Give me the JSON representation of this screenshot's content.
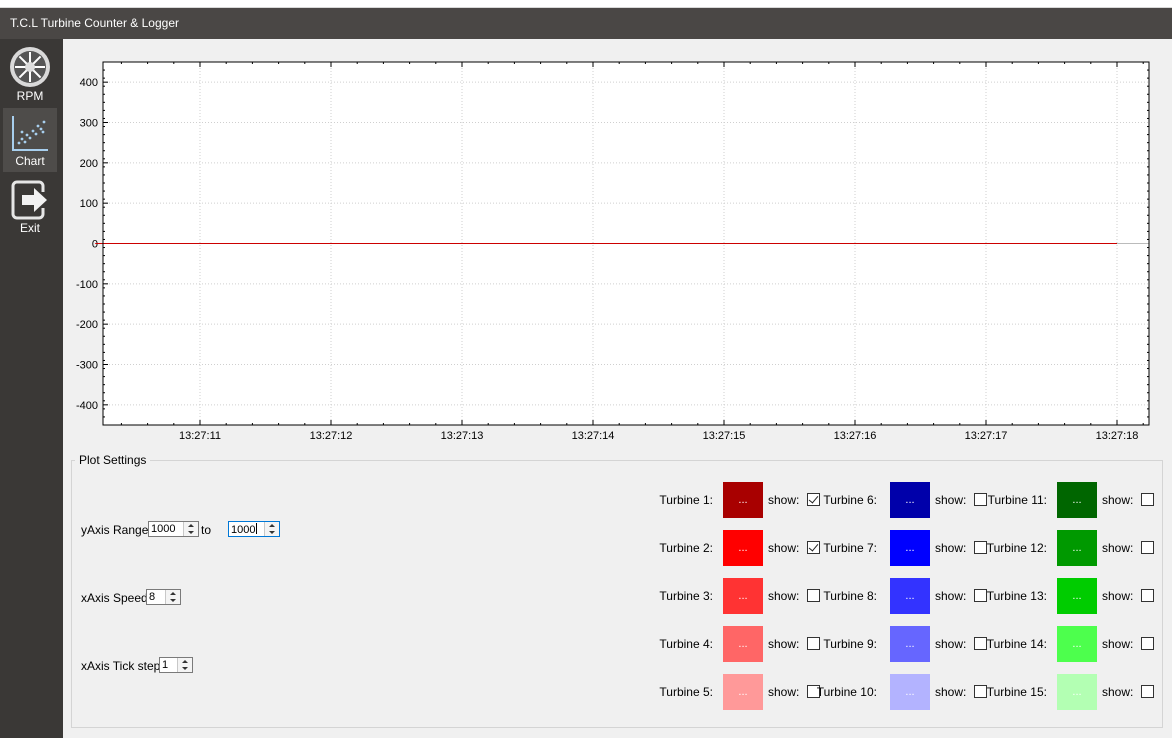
{
  "window": {
    "title": "T.C.L Turbine Counter & Logger"
  },
  "sidebar": {
    "items": [
      {
        "label": "RPM",
        "icon": "turbine-icon",
        "active": false
      },
      {
        "label": "Chart",
        "icon": "scatter-chart-icon",
        "active": true
      },
      {
        "label": "Exit",
        "icon": "exit-icon",
        "active": false
      }
    ]
  },
  "chart_data": {
    "type": "line",
    "title": "",
    "xlabel": "",
    "ylabel": "",
    "ylim": [
      -450,
      450
    ],
    "y_ticks": [
      "400",
      "300",
      "200",
      "100",
      "0",
      "-100",
      "-200",
      "-300",
      "-400"
    ],
    "x_ticks": [
      "13:27:11",
      "13:27:12",
      "13:27:13",
      "13:27:14",
      "13:27:15",
      "13:27:16",
      "13:27:17",
      "13:27:18"
    ],
    "grid": true,
    "series": [
      {
        "color": "#cc0000",
        "x": [
          "13:27:10.2",
          "13:27:18"
        ],
        "y": [
          0,
          0
        ]
      }
    ]
  },
  "plot_settings": {
    "title": "Plot Settings",
    "y_range_label": "yAxis Range:",
    "y_from": "1000",
    "to_label": "to",
    "y_to": "1000",
    "x_speed_label": "xAxis Speed:",
    "x_speed": "8",
    "x_tick_label": "xAxis Tick step:",
    "x_tick": "1",
    "show_label": "show:",
    "btn_text": "...",
    "turbines": [
      {
        "label": "Turbine 1:",
        "color": "#a80000",
        "show": true
      },
      {
        "label": "Turbine 2:",
        "color": "#ff0000",
        "show": true
      },
      {
        "label": "Turbine 3:",
        "color": "#ff3333",
        "show": false
      },
      {
        "label": "Turbine 4:",
        "color": "#ff6666",
        "show": false
      },
      {
        "label": "Turbine 5:",
        "color": "#ff9999",
        "show": false
      },
      {
        "label": "Turbine 6:",
        "color": "#0000aa",
        "show": false
      },
      {
        "label": "Turbine 7:",
        "color": "#0000ff",
        "show": false
      },
      {
        "label": "Turbine 8:",
        "color": "#3333ff",
        "show": false
      },
      {
        "label": "Turbine 9:",
        "color": "#6666ff",
        "show": false
      },
      {
        "label": "Turbine 10:",
        "color": "#b3b3ff",
        "show": false
      },
      {
        "label": "Turbine 11:",
        "color": "#006600",
        "show": false
      },
      {
        "label": "Turbine 12:",
        "color": "#009900",
        "show": false
      },
      {
        "label": "Turbine 13:",
        "color": "#00cc00",
        "show": false
      },
      {
        "label": "Turbine 14:",
        "color": "#4dff4d",
        "show": false
      },
      {
        "label": "Turbine 15:",
        "color": "#b3ffb3",
        "show": false
      }
    ]
  }
}
